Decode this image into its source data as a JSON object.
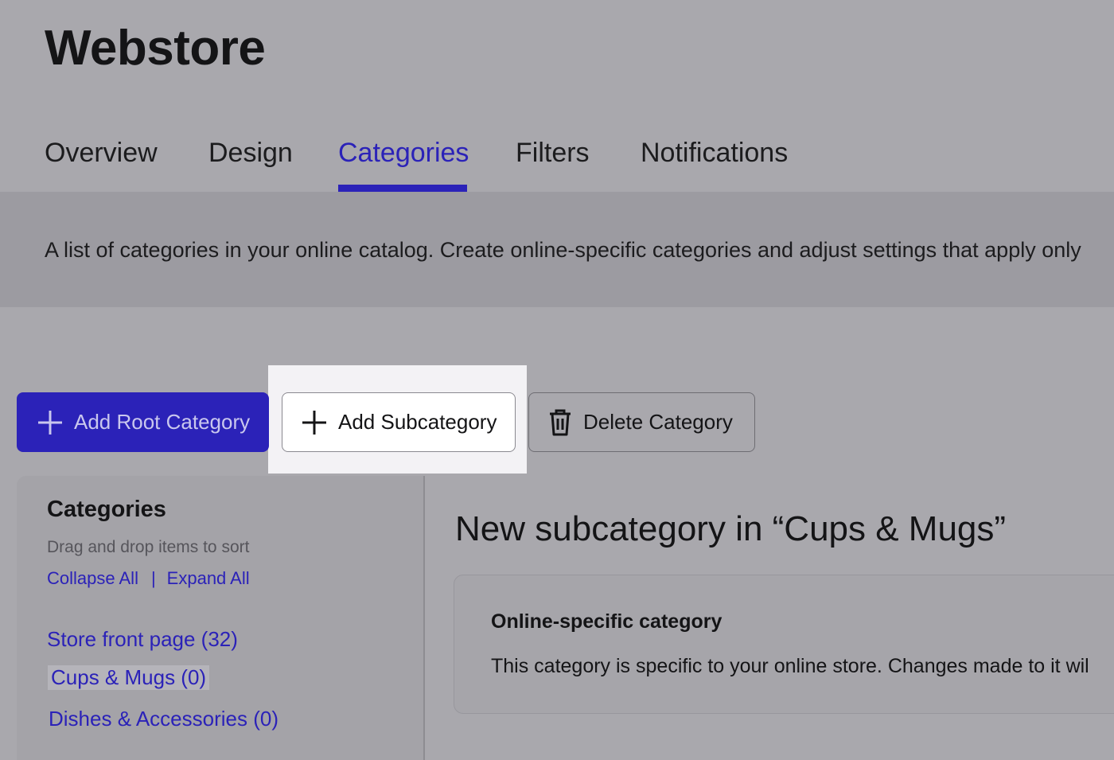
{
  "app": {
    "title": "Webstore"
  },
  "tabs": [
    {
      "label": "Overview",
      "active": false
    },
    {
      "label": "Design",
      "active": false
    },
    {
      "label": "Categories",
      "active": true
    },
    {
      "label": "Filters",
      "active": false
    },
    {
      "label": "Notifications",
      "active": false
    }
  ],
  "description": "A list of categories in your online catalog. Create online-specific categories and adjust settings that apply only",
  "toolbar": {
    "add_root_label": "Add Root Category",
    "add_sub_label": "Add Subcategory",
    "delete_label": "Delete Category",
    "add_root_icon": "plus-icon",
    "add_sub_icon": "plus-icon",
    "delete_icon": "trash-icon"
  },
  "sidebar": {
    "title": "Categories",
    "hint": "Drag and drop items to sort",
    "collapse_all": "Collapse All",
    "separator": "|",
    "expand_all": "Expand All",
    "items": [
      {
        "label": "Store front page (32)",
        "selected": false
      },
      {
        "label": "Cups & Mugs (0)",
        "selected": true
      },
      {
        "label": "Dishes & Accessories (0)",
        "selected": false
      }
    ]
  },
  "main": {
    "title": "New subcategory in “Cups & Mugs”",
    "card": {
      "title": "Online-specific category",
      "text": "This category is specific to your online store. Changes made to it wil"
    }
  },
  "colors": {
    "accent": "#2b22b8",
    "overlay_background": "#a9a8ad",
    "highlight": "#f3f2f5"
  }
}
